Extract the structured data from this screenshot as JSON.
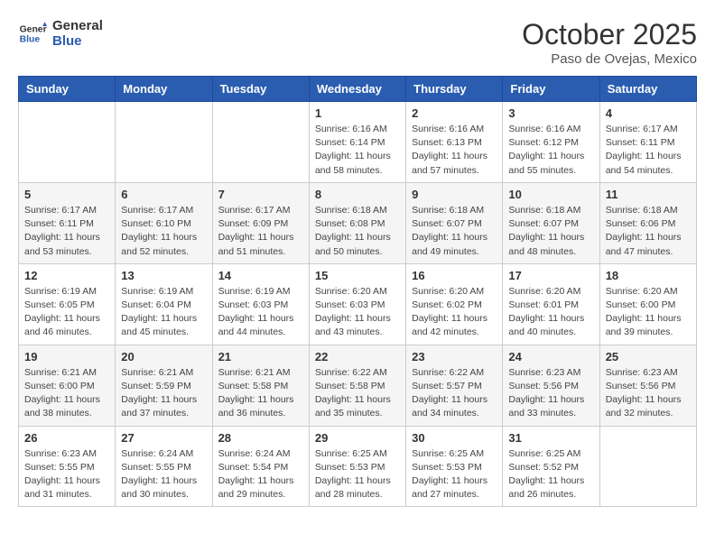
{
  "logo": {
    "line1": "General",
    "line2": "Blue"
  },
  "title": "October 2025",
  "subtitle": "Paso de Ovejas, Mexico",
  "days_of_week": [
    "Sunday",
    "Monday",
    "Tuesday",
    "Wednesday",
    "Thursday",
    "Friday",
    "Saturday"
  ],
  "weeks": [
    [
      {
        "day": "",
        "info": ""
      },
      {
        "day": "",
        "info": ""
      },
      {
        "day": "",
        "info": ""
      },
      {
        "day": "1",
        "info": "Sunrise: 6:16 AM\nSunset: 6:14 PM\nDaylight: 11 hours\nand 58 minutes."
      },
      {
        "day": "2",
        "info": "Sunrise: 6:16 AM\nSunset: 6:13 PM\nDaylight: 11 hours\nand 57 minutes."
      },
      {
        "day": "3",
        "info": "Sunrise: 6:16 AM\nSunset: 6:12 PM\nDaylight: 11 hours\nand 55 minutes."
      },
      {
        "day": "4",
        "info": "Sunrise: 6:17 AM\nSunset: 6:11 PM\nDaylight: 11 hours\nand 54 minutes."
      }
    ],
    [
      {
        "day": "5",
        "info": "Sunrise: 6:17 AM\nSunset: 6:11 PM\nDaylight: 11 hours\nand 53 minutes."
      },
      {
        "day": "6",
        "info": "Sunrise: 6:17 AM\nSunset: 6:10 PM\nDaylight: 11 hours\nand 52 minutes."
      },
      {
        "day": "7",
        "info": "Sunrise: 6:17 AM\nSunset: 6:09 PM\nDaylight: 11 hours\nand 51 minutes."
      },
      {
        "day": "8",
        "info": "Sunrise: 6:18 AM\nSunset: 6:08 PM\nDaylight: 11 hours\nand 50 minutes."
      },
      {
        "day": "9",
        "info": "Sunrise: 6:18 AM\nSunset: 6:07 PM\nDaylight: 11 hours\nand 49 minutes."
      },
      {
        "day": "10",
        "info": "Sunrise: 6:18 AM\nSunset: 6:07 PM\nDaylight: 11 hours\nand 48 minutes."
      },
      {
        "day": "11",
        "info": "Sunrise: 6:18 AM\nSunset: 6:06 PM\nDaylight: 11 hours\nand 47 minutes."
      }
    ],
    [
      {
        "day": "12",
        "info": "Sunrise: 6:19 AM\nSunset: 6:05 PM\nDaylight: 11 hours\nand 46 minutes."
      },
      {
        "day": "13",
        "info": "Sunrise: 6:19 AM\nSunset: 6:04 PM\nDaylight: 11 hours\nand 45 minutes."
      },
      {
        "day": "14",
        "info": "Sunrise: 6:19 AM\nSunset: 6:03 PM\nDaylight: 11 hours\nand 44 minutes."
      },
      {
        "day": "15",
        "info": "Sunrise: 6:20 AM\nSunset: 6:03 PM\nDaylight: 11 hours\nand 43 minutes."
      },
      {
        "day": "16",
        "info": "Sunrise: 6:20 AM\nSunset: 6:02 PM\nDaylight: 11 hours\nand 42 minutes."
      },
      {
        "day": "17",
        "info": "Sunrise: 6:20 AM\nSunset: 6:01 PM\nDaylight: 11 hours\nand 40 minutes."
      },
      {
        "day": "18",
        "info": "Sunrise: 6:20 AM\nSunset: 6:00 PM\nDaylight: 11 hours\nand 39 minutes."
      }
    ],
    [
      {
        "day": "19",
        "info": "Sunrise: 6:21 AM\nSunset: 6:00 PM\nDaylight: 11 hours\nand 38 minutes."
      },
      {
        "day": "20",
        "info": "Sunrise: 6:21 AM\nSunset: 5:59 PM\nDaylight: 11 hours\nand 37 minutes."
      },
      {
        "day": "21",
        "info": "Sunrise: 6:21 AM\nSunset: 5:58 PM\nDaylight: 11 hours\nand 36 minutes."
      },
      {
        "day": "22",
        "info": "Sunrise: 6:22 AM\nSunset: 5:58 PM\nDaylight: 11 hours\nand 35 minutes."
      },
      {
        "day": "23",
        "info": "Sunrise: 6:22 AM\nSunset: 5:57 PM\nDaylight: 11 hours\nand 34 minutes."
      },
      {
        "day": "24",
        "info": "Sunrise: 6:23 AM\nSunset: 5:56 PM\nDaylight: 11 hours\nand 33 minutes."
      },
      {
        "day": "25",
        "info": "Sunrise: 6:23 AM\nSunset: 5:56 PM\nDaylight: 11 hours\nand 32 minutes."
      }
    ],
    [
      {
        "day": "26",
        "info": "Sunrise: 6:23 AM\nSunset: 5:55 PM\nDaylight: 11 hours\nand 31 minutes."
      },
      {
        "day": "27",
        "info": "Sunrise: 6:24 AM\nSunset: 5:55 PM\nDaylight: 11 hours\nand 30 minutes."
      },
      {
        "day": "28",
        "info": "Sunrise: 6:24 AM\nSunset: 5:54 PM\nDaylight: 11 hours\nand 29 minutes."
      },
      {
        "day": "29",
        "info": "Sunrise: 6:25 AM\nSunset: 5:53 PM\nDaylight: 11 hours\nand 28 minutes."
      },
      {
        "day": "30",
        "info": "Sunrise: 6:25 AM\nSunset: 5:53 PM\nDaylight: 11 hours\nand 27 minutes."
      },
      {
        "day": "31",
        "info": "Sunrise: 6:25 AM\nSunset: 5:52 PM\nDaylight: 11 hours\nand 26 minutes."
      },
      {
        "day": "",
        "info": ""
      }
    ]
  ]
}
